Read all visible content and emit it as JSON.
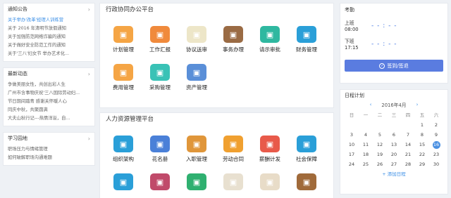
{
  "announcements": {
    "title": "通知公告",
    "items": [
      "关于举办'改革'经理人训练营",
      "关于 2016 年清明节放假通知",
      "关于加强防范网络诈骗的通知",
      "关于做好安全防范工作的通知",
      "关于'三八'妇女节 举办艺术化..."
    ]
  },
  "news": {
    "title": "最新动态",
    "items": [
      "争做美丽女性，共创出彩人生",
      "广州市含事物庆祝'三八国际劳动妇...",
      "节日期间踏青 感谢关怀暖人心",
      "同庆中秋，共聚圆满",
      "大夫山秋行记---热情洋溢，自..."
    ]
  },
  "learning": {
    "title": "学习园地",
    "items": [
      "职场压力与情绪管理",
      "如何破解职场沟通难题"
    ]
  },
  "office_platform": {
    "title": "行政协同办公平台",
    "apps": [
      {
        "label": "计划管理",
        "icon": "plan-icon",
        "color": "#f5a545"
      },
      {
        "label": "工作汇报",
        "icon": "report-icon",
        "color": "#f08a3c"
      },
      {
        "label": "协议送审",
        "icon": "contract-icon",
        "color": "#ede6c8"
      },
      {
        "label": "事务办理",
        "icon": "briefcase-icon",
        "color": "#9a6b44"
      },
      {
        "label": "请示审批",
        "icon": "approval-icon",
        "color": "#2fb8a0"
      },
      {
        "label": "财务管理",
        "icon": "finance-icon",
        "color": "#2a9fd8"
      },
      {
        "label": "费用管理",
        "icon": "expense-icon",
        "color": "#f5a545"
      },
      {
        "label": "采购管理",
        "icon": "cart-icon",
        "color": "#39c2b6"
      },
      {
        "label": "资产管理",
        "icon": "asset-icon",
        "color": "#5a8fd8"
      }
    ]
  },
  "hr_platform": {
    "title": "人力资源管理平台",
    "apps": [
      {
        "label": "组织架构",
        "icon": "org-icon",
        "color": "#2a9fd8"
      },
      {
        "label": "花名册",
        "icon": "roster-icon",
        "color": "#4a80d8"
      },
      {
        "label": "入职管理",
        "icon": "onboard-icon",
        "color": "#e0963a"
      },
      {
        "label": "劳动合同",
        "icon": "labor-contract-icon",
        "color": "#f0a030"
      },
      {
        "label": "薪酬计发",
        "icon": "salary-icon",
        "color": "#e85a4a"
      },
      {
        "label": "社会保障",
        "icon": "insurance-icon",
        "color": "#2a9fd8"
      },
      {
        "label": "",
        "icon": "hr-icon-7",
        "color": "#2a9fd8"
      },
      {
        "label": "",
        "icon": "hr-icon-8",
        "color": "#c04a6a"
      },
      {
        "label": "",
        "icon": "hr-icon-9",
        "color": "#2fb070"
      },
      {
        "label": "",
        "icon": "hr-icon-10",
        "color": "#e8e0d0"
      },
      {
        "label": "",
        "icon": "hr-icon-11",
        "color": "#e8dcc8"
      },
      {
        "label": "",
        "icon": "hr-icon-12",
        "color": "#a06a3a"
      }
    ]
  },
  "attendance": {
    "title": "考勤",
    "checkin_label": "上班",
    "checkin_time": "08:00",
    "checkout_label": "下班",
    "checkout_time": "17:15",
    "placeholder": "- - : - -",
    "button_label": "签到/签退",
    "accent": "#5a7ce0"
  },
  "calendar": {
    "title": "日程计划",
    "month_label": "2016年4月",
    "weekdays": [
      "日",
      "一",
      "二",
      "三",
      "四",
      "五",
      "六"
    ],
    "days": [
      "",
      "",
      "",
      "",
      "",
      "1",
      "2",
      "3",
      "4",
      "5",
      "6",
      "7",
      "8",
      "9",
      "10",
      "11",
      "12",
      "13",
      "14",
      "15",
      "16",
      "17",
      "18",
      "19",
      "20",
      "21",
      "22",
      "23",
      "24",
      "25",
      "26",
      "27",
      "28",
      "29",
      "30"
    ],
    "today": "16",
    "add_label": "添加日程"
  }
}
